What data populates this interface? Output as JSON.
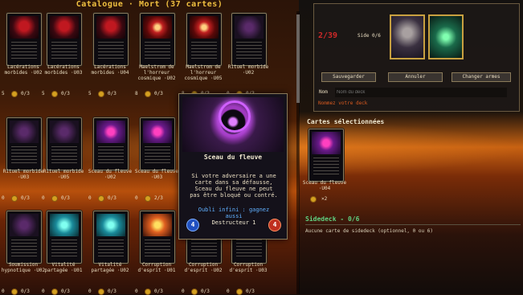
{
  "catalog": {
    "title": "Catalogue · Mort (37 cartes)",
    "cards": [
      {
        "name": "Lacérations morbides",
        "code": "·U02",
        "qty": "5",
        "owned": "0/3",
        "style": "red"
      },
      {
        "name": "Lacérations morbides",
        "code": "·U03",
        "qty": "5",
        "owned": "0/3",
        "style": "red"
      },
      {
        "name": "Lacérations morbides",
        "code": "·U04",
        "qty": "5",
        "owned": "0/3",
        "style": "red"
      },
      {
        "name": "Maelstrom de l'horreur cosmique",
        "code": "·U02",
        "qty": "8",
        "owned": "0/3",
        "style": "vortex"
      },
      {
        "name": "Maelstrom de l'horreur cosmique",
        "code": "·U05",
        "qty": "8",
        "owned": "0/3",
        "style": "vortex"
      },
      {
        "name": "Rituel morbide",
        "code": "·U02",
        "qty": "0",
        "owned": "0/3",
        "style": "dark"
      },
      {
        "name": "Rituel morbide",
        "code": "·U03",
        "qty": "0",
        "owned": "0/3",
        "style": "dark"
      },
      {
        "name": "Rituel morbide",
        "code": "·U05",
        "qty": "0",
        "owned": "0/3",
        "style": "dark"
      },
      {
        "name": "Sceau du fleuve",
        "code": "·U02",
        "qty": "0",
        "owned": "0/3",
        "style": "purple"
      },
      {
        "name": "Sceau du fleuve",
        "code": "·U03",
        "qty": "0",
        "owned": "2/3",
        "style": "purple"
      },
      {
        "name": "Sceau du fleuve",
        "code": "",
        "qty": "0",
        "owned": "0/3",
        "style": "purple"
      },
      {
        "name": "Soumission hypnotique",
        "code": "·U02",
        "qty": "0",
        "owned": "0/3",
        "style": "dark"
      },
      {
        "name": "Vitalité partagée",
        "code": "·U01",
        "qty": "0",
        "owned": "0/3",
        "style": "teal"
      },
      {
        "name": "Vitalité partagée",
        "code": "·U02",
        "qty": "0",
        "owned": "0/3",
        "style": "teal"
      },
      {
        "name": "Corruption d'esprit",
        "code": "·U01",
        "qty": "0",
        "owned": "0/3",
        "style": "fire"
      },
      {
        "name": "Corruption d'esprit",
        "code": "·U02",
        "qty": "0",
        "owned": "0/3",
        "style": "fire"
      },
      {
        "name": "Corruption d'esprit",
        "code": "·U03",
        "qty": "0",
        "owned": "0/3",
        "style": "green"
      }
    ]
  },
  "popup": {
    "title": "Sceau du fleuve",
    "text": "Si votre adversaire a une carte dans sa défausse, Sceau du fleuve ne peut pas être bloqué ou contré.",
    "keyword1": "Oubli infini : gagnez aussi",
    "keyword2": "Destructeur 1",
    "cost_left": "4",
    "cost_right": "4"
  },
  "deck": {
    "counter": "2/39",
    "side_label": "Side 0/6",
    "buttons": {
      "save": "Sauvegarder",
      "cancel": "Annuler",
      "change": "Changer armes"
    },
    "name_label": "Nom",
    "name_placeholder": "Nom du deck",
    "hint": "Nommez votre deck",
    "selected_title": "Cartes sélectionnées",
    "selected_card": {
      "name": "Sceau du fleuve",
      "code": "·U04",
      "qty": "×2"
    },
    "sidedeck_title": "Sidedeck - 0/6",
    "sidedeck_note": "Aucune carte de sidedeck (optionnel, 0 ou 6)"
  },
  "colors": {
    "accent_gold": "#f0c040",
    "counter_red": "#d02828",
    "sidedeck_green": "#60d080",
    "hint_orange": "#d85a20"
  }
}
